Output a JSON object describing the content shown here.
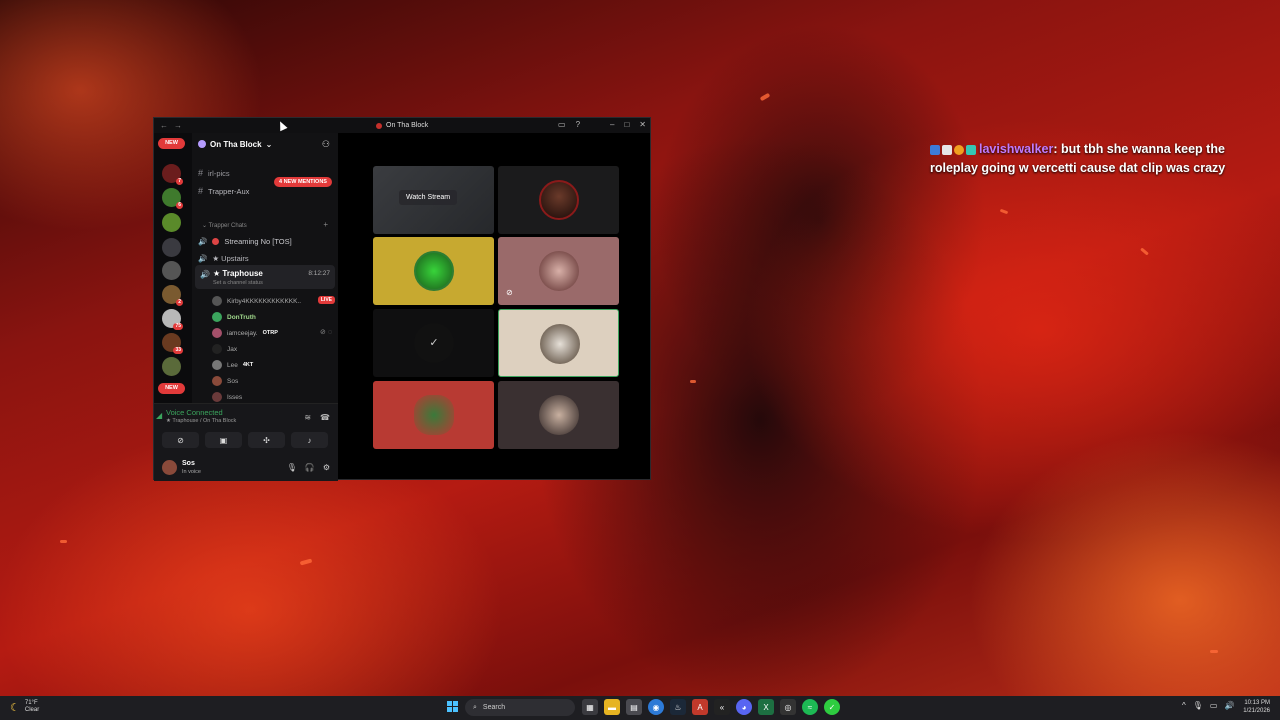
{
  "chat": {
    "username": "lavishwalker",
    "message": ": but tbh she wanna keep the roleplay going w vercetti cause dat clip was crazy"
  },
  "window": {
    "title": "On Tha Block"
  },
  "server_rail": {
    "new_top": "NEW",
    "new_bottom": "NEW",
    "badges": [
      "7",
      "6",
      "2",
      "75",
      "33"
    ]
  },
  "server": {
    "name": "On Tha Block",
    "mentions_pill": "4 NEW MENTIONS"
  },
  "channels": {
    "top1": "irl-pics",
    "top2": "Trapper-Aux",
    "category": "Trapper Chats",
    "voice1": "Streaming No [TOS]",
    "voice2": "★ Upstairs",
    "active_voice": "★ Traphouse",
    "active_time": "8:12:27",
    "active_status": "Set a channel status"
  },
  "voice_users": [
    {
      "name": "Kirby4KKKKKKKKKKKK..",
      "tag": "LIVE"
    },
    {
      "name": "DonTruth",
      "tag": ""
    },
    {
      "name": "iamceejay.",
      "tag": "OTRP"
    },
    {
      "name": "Jax",
      "tag": ""
    },
    {
      "name": "Lee",
      "tag": "4KT"
    },
    {
      "name": "Sos",
      "tag": ""
    },
    {
      "name": "Isses",
      "tag": ""
    }
  ],
  "voice_panel": {
    "status": "Voice Connected",
    "location": "★ Traphouse / On Tha Block"
  },
  "user_bar": {
    "name": "Sos",
    "status": "In voice"
  },
  "stage": {
    "watch_stream": "Watch Stream"
  },
  "taskbar": {
    "temp": "71°F",
    "condition": "Clear",
    "search_placeholder": "Search",
    "time": "10:13 PM",
    "date": "1/21/2026"
  },
  "colors": {
    "accent_red": "#e23a3a",
    "voice_green": "#3ba55d",
    "chat_user_purple": "#c07bff"
  }
}
